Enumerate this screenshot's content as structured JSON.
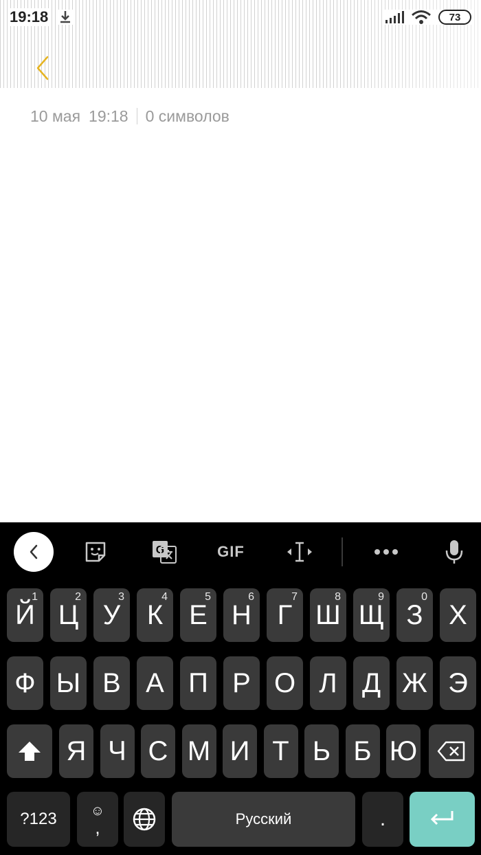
{
  "status_bar": {
    "time": "19:18",
    "battery": "73",
    "icons": [
      "download-icon",
      "signal-icon",
      "wifi-icon",
      "battery-icon"
    ]
  },
  "header": {
    "back_icon": "chevron-left-icon",
    "accent_color": "#e6b422"
  },
  "note": {
    "date": "10 мая",
    "time": "19:18",
    "char_count": "0 символов",
    "body": ""
  },
  "keyboard": {
    "toolbar": {
      "collapse_icon": "chevron-left-icon",
      "items": [
        "sticker-icon",
        "translate-icon",
        "gif-button",
        "text-cursor-icon",
        "more-icon",
        "microphone-icon"
      ],
      "gif_label": "GIF"
    },
    "row1": [
      {
        "char": "Й",
        "hint": "1"
      },
      {
        "char": "Ц",
        "hint": "2"
      },
      {
        "char": "У",
        "hint": "3"
      },
      {
        "char": "К",
        "hint": "4"
      },
      {
        "char": "Е",
        "hint": "5"
      },
      {
        "char": "Н",
        "hint": "6"
      },
      {
        "char": "Г",
        "hint": "7"
      },
      {
        "char": "Ш",
        "hint": "8"
      },
      {
        "char": "Щ",
        "hint": "9"
      },
      {
        "char": "З",
        "hint": "0"
      },
      {
        "char": "Х",
        "hint": ""
      }
    ],
    "row2": [
      "Ф",
      "Ы",
      "В",
      "А",
      "П",
      "Р",
      "О",
      "Л",
      "Д",
      "Ж",
      "Э"
    ],
    "row3": [
      "Я",
      "Ч",
      "С",
      "М",
      "И",
      "Т",
      "Ь",
      "Б",
      "Ю"
    ],
    "bottom": {
      "symbols_label": "?123",
      "comma_label": ",",
      "emoji_hint": "☺",
      "space_label": "Русский",
      "period_label": ".",
      "enter_icon": "enter-icon"
    },
    "colors": {
      "background": "#000000",
      "key": "#3a3a3a",
      "enter": "#79cfc4"
    }
  }
}
